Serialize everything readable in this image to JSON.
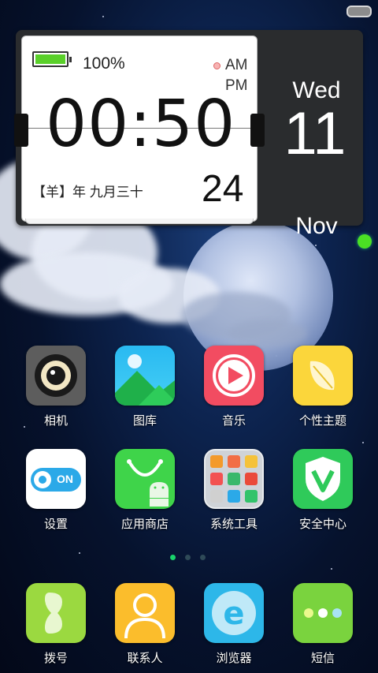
{
  "widget": {
    "battery_percent": "100%",
    "am": "AM",
    "pm": "PM",
    "time": "00:50",
    "lunar_date": "【羊】年 九月三十",
    "day": "24",
    "weekday": "Wed",
    "date": "11",
    "month": "Nov"
  },
  "home_rows": [
    [
      {
        "label": "相机",
        "icon": "camera-icon"
      },
      {
        "label": "图库",
        "icon": "gallery-icon"
      },
      {
        "label": "音乐",
        "icon": "music-icon"
      },
      {
        "label": "个性主题",
        "icon": "theme-icon"
      }
    ],
    [
      {
        "label": "设置",
        "icon": "settings-icon",
        "toggle_text": "ON"
      },
      {
        "label": "应用商店",
        "icon": "app-store-icon"
      },
      {
        "label": "系统工具",
        "icon": "system-tools-folder-icon"
      },
      {
        "label": "安全中心",
        "icon": "security-center-icon"
      }
    ]
  ],
  "page_indicator": {
    "count": 3,
    "active": 0
  },
  "dock": [
    {
      "label": "拨号",
      "icon": "phone-icon"
    },
    {
      "label": "联系人",
      "icon": "contacts-icon"
    },
    {
      "label": "浏览器",
      "icon": "browser-icon"
    },
    {
      "label": "短信",
      "icon": "messages-icon"
    }
  ],
  "colors": {
    "battery": "#5ad02a",
    "indicator_active": "#19d36b",
    "indicator_inactive": "#2f4a58"
  }
}
